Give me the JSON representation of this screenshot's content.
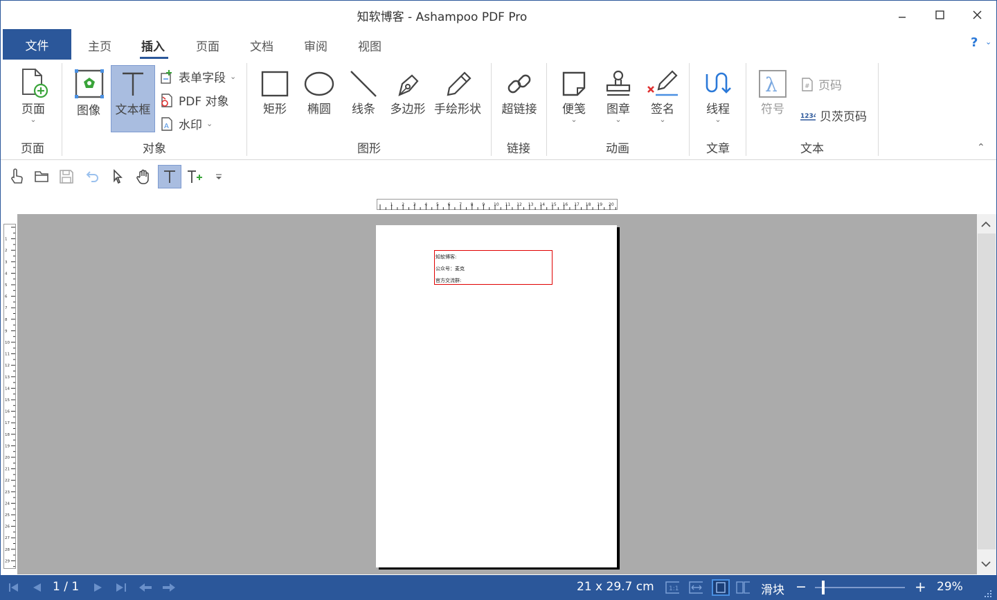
{
  "window": {
    "title": "知软博客 - Ashampoo PDF Pro",
    "minimize_icon": "minimize-icon",
    "maximize_icon": "maximize-icon",
    "close_icon": "close-icon"
  },
  "tabs": {
    "file": "文件",
    "items": [
      "主页",
      "插入",
      "页面",
      "文档",
      "审阅",
      "视图"
    ],
    "active": "插入",
    "help": "?"
  },
  "ribbon": {
    "groups": {
      "page": "页面",
      "object": "对象",
      "shape": "图形",
      "link": "链接",
      "anim": "动画",
      "article": "文章",
      "text": "文本"
    },
    "buttons": {
      "page": "页面",
      "image": "图像",
      "textbox": "文本框",
      "form_field": "表单字段",
      "pdf_object": "PDF 对象",
      "watermark": "水印",
      "rect": "矩形",
      "ellipse": "椭圆",
      "line": "线条",
      "polygon": "多边形",
      "freehand": "手绘形状",
      "hyperlink": "超链接",
      "note": "便笺",
      "stamp": "图章",
      "signature": "签名",
      "thread": "线程",
      "symbol": "符号",
      "page_number": "页码",
      "bates": "贝茨页码"
    }
  },
  "document": {
    "textbox_lines": [
      "知软博客:",
      "公众号：麦克",
      "官方交流群:"
    ]
  },
  "status": {
    "page": "1 / 1",
    "size": "21 x 29.7 cm",
    "zoom_mode": "滑块",
    "zoom_percent": "29%",
    "zoom_fraction": 0.08,
    "minus": "−",
    "plus": "+"
  },
  "colors": {
    "accent": "#2b579a",
    "canvas": "#ababab",
    "selected": "#a9bde0",
    "textbox_border": "#e00000"
  }
}
